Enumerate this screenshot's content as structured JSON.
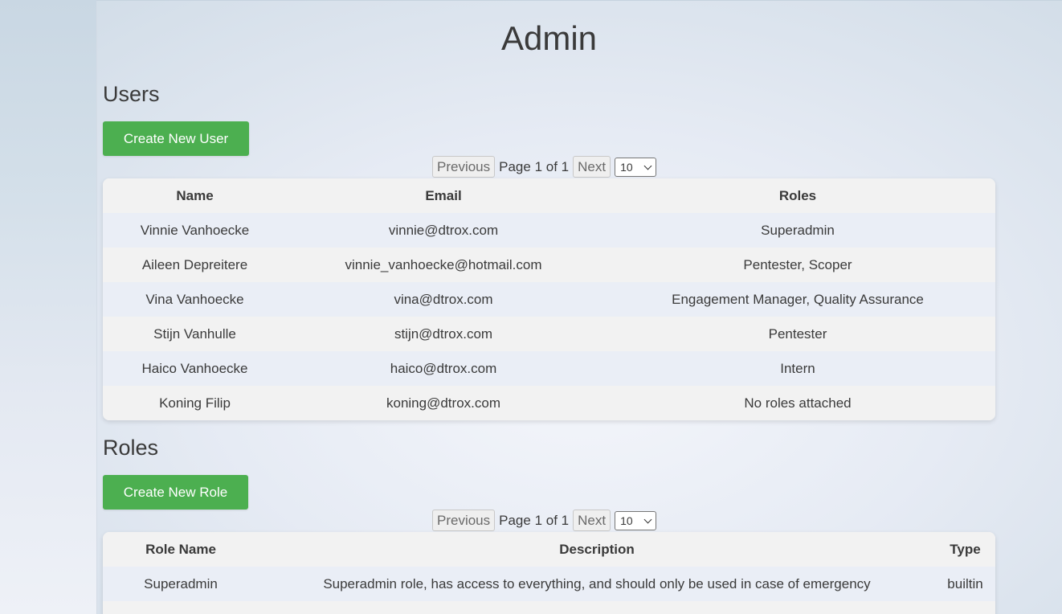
{
  "page": {
    "title": "Admin"
  },
  "users_section": {
    "title": "Users",
    "create_button": "Create New User",
    "pager": {
      "previous": "Previous",
      "page_text": "Page 1 of 1",
      "next": "Next",
      "page_size": "10"
    },
    "columns": [
      "Name",
      "Email",
      "Roles"
    ],
    "rows": [
      {
        "name": "Vinnie Vanhoecke",
        "email": "vinnie@dtrox.com",
        "roles": "Superadmin"
      },
      {
        "name": "Aileen Depreitere",
        "email": "vinnie_vanhoecke@hotmail.com",
        "roles": "Pentester, Scoper"
      },
      {
        "name": "Vina Vanhoecke",
        "email": "vina@dtrox.com",
        "roles": "Engagement Manager, Quality Assurance"
      },
      {
        "name": "Stijn Vanhulle",
        "email": "stijn@dtrox.com",
        "roles": "Pentester"
      },
      {
        "name": "Haico Vanhoecke",
        "email": "haico@dtrox.com",
        "roles": "Intern"
      },
      {
        "name": "Koning Filip",
        "email": "koning@dtrox.com",
        "roles": "No roles attached"
      }
    ]
  },
  "roles_section": {
    "title": "Roles",
    "create_button": "Create New Role",
    "pager": {
      "previous": "Previous",
      "page_text": "Page 1 of 1",
      "next": "Next",
      "page_size": "10"
    },
    "columns": [
      "Role Name",
      "Description",
      "Type"
    ],
    "rows": [
      {
        "name": "Superadmin",
        "description": "Superadmin role, has access to everything, and should only be used in case of emergency",
        "type": "builtin"
      }
    ]
  },
  "colors": {
    "accent": "#4caf50"
  },
  "icons": {
    "select_arrow": "chevron-down-icon"
  }
}
